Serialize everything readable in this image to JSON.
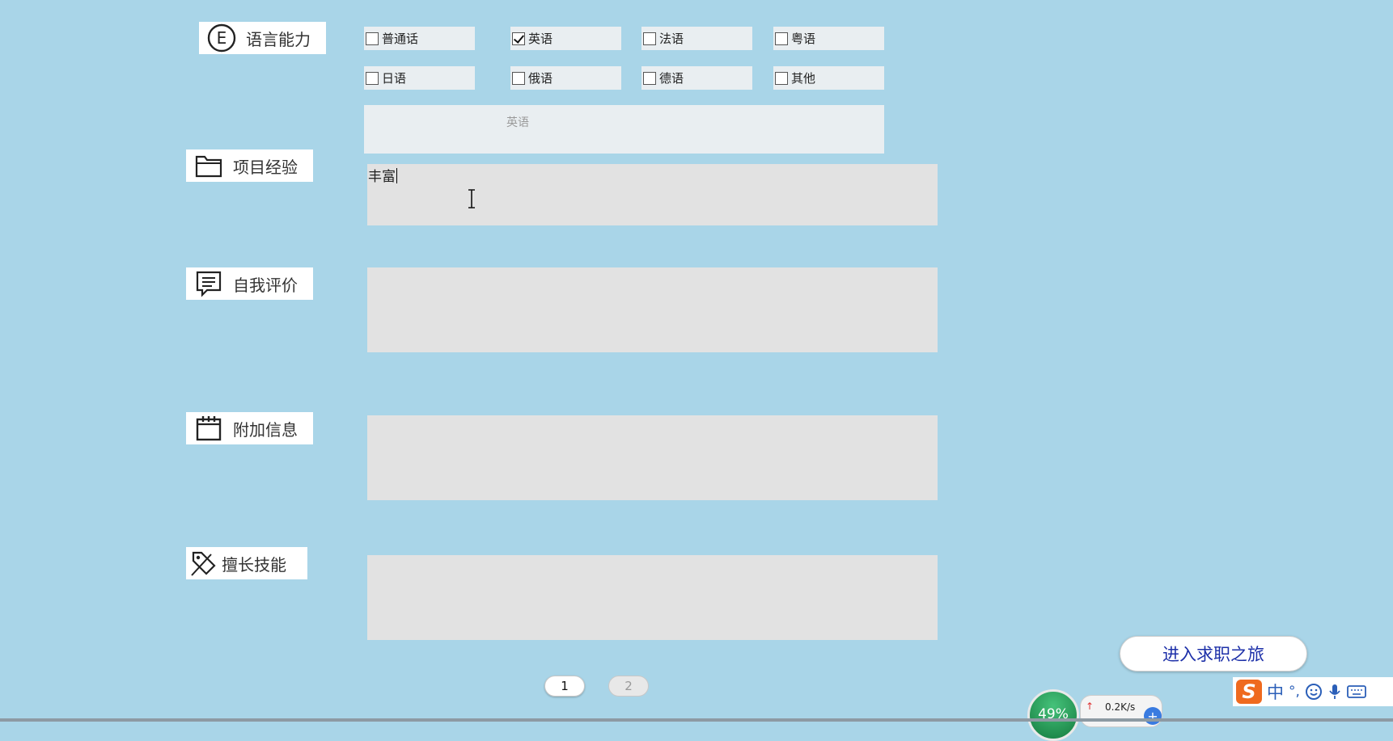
{
  "sections": {
    "language": {
      "label": "语言能力",
      "icon": "letter-e-circle-icon"
    },
    "project": {
      "label": "项目经验",
      "icon": "folder-icon"
    },
    "self_eval": {
      "label": "自我评价",
      "icon": "comment-icon"
    },
    "extra": {
      "label": "附加信息",
      "icon": "calendar-icon"
    },
    "skills": {
      "label": "擅长技能",
      "icon": "tag-icon"
    }
  },
  "languages": [
    {
      "label": "普通话",
      "checked": false
    },
    {
      "label": "英语",
      "checked": true
    },
    {
      "label": "法语",
      "checked": false
    },
    {
      "label": "粤语",
      "checked": false
    },
    {
      "label": "日语",
      "checked": false
    },
    {
      "label": "俄语",
      "checked": false
    },
    {
      "label": "德语",
      "checked": false
    },
    {
      "label": "其他",
      "checked": false
    }
  ],
  "language_input": {
    "placeholder": "英语"
  },
  "project_text": "丰富",
  "self_eval_text": "",
  "extra_text": "",
  "skills_text": "",
  "pagination": {
    "page1": "1",
    "page2": "2"
  },
  "cta_label": "进入求职之旅",
  "taskbar": {
    "cpu_percent": "49%",
    "net_speed": "0.2K/s",
    "ime_mode": "中",
    "ime_punct": "°,"
  }
}
